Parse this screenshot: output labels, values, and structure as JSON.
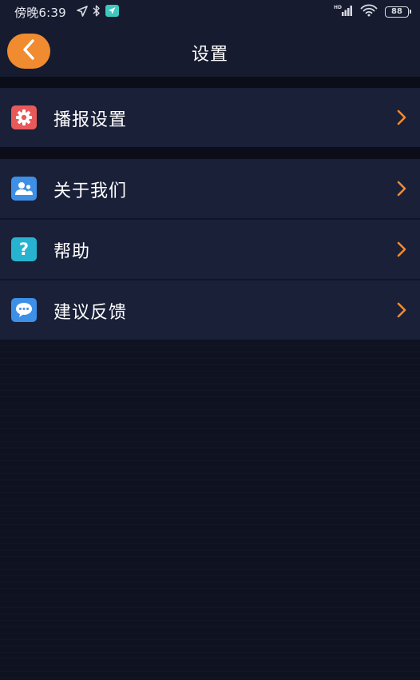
{
  "status_bar": {
    "time": "傍晚6:39",
    "battery": "88"
  },
  "nav": {
    "title": "设置"
  },
  "menu": {
    "items": [
      {
        "label": "播报设置",
        "icon": "gear-icon",
        "icon_color": "#e85a5a"
      },
      {
        "label": "关于我们",
        "icon": "people-icon",
        "icon_color": "#3e8fe6"
      },
      {
        "label": "帮助",
        "icon": "question-icon",
        "icon_color": "#27b3cf"
      },
      {
        "label": "建议反馈",
        "icon": "chat-bubble-icon",
        "icon_color": "#3e8fe6"
      }
    ]
  },
  "colors": {
    "accent": "#f08b2f",
    "background": "#0e1221",
    "row_background": "#1a2038"
  }
}
